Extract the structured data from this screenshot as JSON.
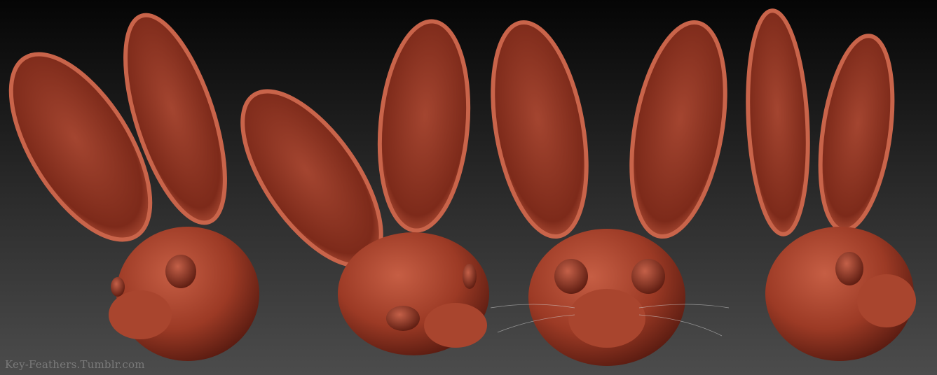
{
  "watermark": {
    "text": "Key-Feathers.Tumblr.com"
  },
  "colors": {
    "sculpt": "#a8432c",
    "sculpt_dark": "#4a140c",
    "sculpt_light": "#d06a4e",
    "background_top": "#050505",
    "background_bottom": "#4c4c4c"
  }
}
